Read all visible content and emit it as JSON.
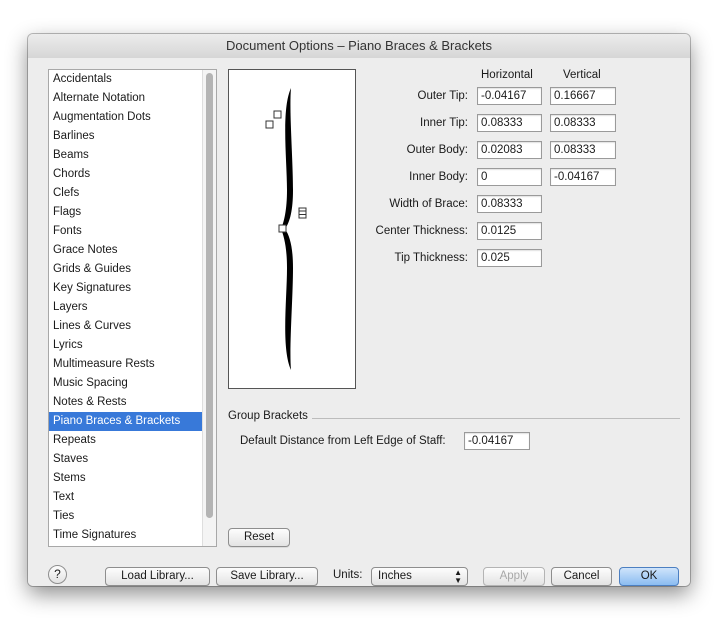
{
  "window": {
    "title": "Document Options – Piano Braces & Brackets"
  },
  "categories": [
    "Accidentals",
    "Alternate Notation",
    "Augmentation Dots",
    "Barlines",
    "Beams",
    "Chords",
    "Clefs",
    "Flags",
    "Fonts",
    "Grace Notes",
    "Grids & Guides",
    "Key Signatures",
    "Layers",
    "Lines & Curves",
    "Lyrics",
    "Multimeasure Rests",
    "Music Spacing",
    "Notes & Rests",
    "Piano Braces & Brackets",
    "Repeats",
    "Staves",
    "Stems",
    "Text",
    "Ties",
    "Time Signatures"
  ],
  "selected_category": "Piano Braces & Brackets",
  "columns": {
    "horizontal": "Horizontal",
    "vertical": "Vertical"
  },
  "fields": {
    "outer_tip": {
      "label": "Outer Tip:",
      "horizontal": "-0.04167",
      "vertical": "0.16667"
    },
    "inner_tip": {
      "label": "Inner Tip:",
      "horizontal": "0.08333",
      "vertical": "0.08333"
    },
    "outer_body": {
      "label": "Outer Body:",
      "horizontal": "0.02083",
      "vertical": "0.08333"
    },
    "inner_body": {
      "label": "Inner Body:",
      "horizontal": "0",
      "vertical": "-0.04167"
    },
    "width_of_brace": {
      "label": "Width of Brace:",
      "value": "0.08333"
    },
    "center_thickness": {
      "label": "Center Thickness:",
      "value": "0.0125"
    },
    "tip_thickness": {
      "label": "Tip Thickness:",
      "value": "0.025"
    }
  },
  "group_brackets": {
    "title": "Group Brackets",
    "distance_label": "Default Distance from Left Edge of Staff:",
    "distance_value": "-0.04167"
  },
  "buttons": {
    "reset": "Reset",
    "help": "?",
    "load_library": "Load Library...",
    "save_library": "Save Library...",
    "apply": "Apply",
    "cancel": "Cancel",
    "ok": "OK"
  },
  "units": {
    "label": "Units:",
    "value": "Inches"
  },
  "colors": {
    "selection": "#3879d9",
    "default_button": "#8bbcf1"
  }
}
